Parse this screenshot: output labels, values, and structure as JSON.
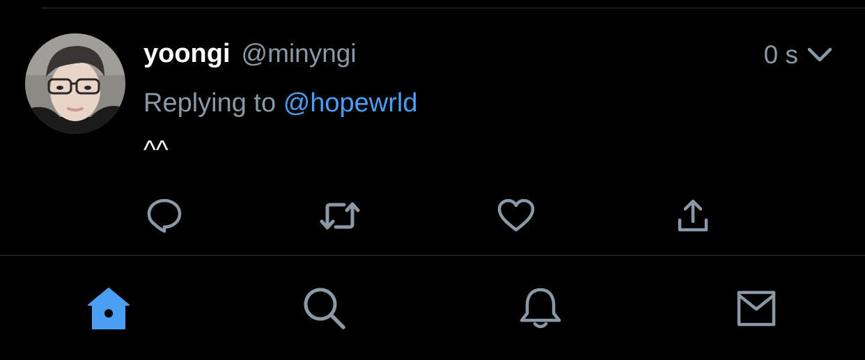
{
  "tweet": {
    "display_name": "yoongi",
    "handle": "@minyngi",
    "timestamp": "0 s",
    "reply_prefix": "Replying to",
    "reply_to": "@hopewrld",
    "text": "^^",
    "menu_icon": "chevron-down-icon",
    "actions": [
      {
        "name": "reply",
        "icon": "reply-bubble-icon"
      },
      {
        "name": "retweet",
        "icon": "retweet-icon"
      },
      {
        "name": "like",
        "icon": "heart-icon"
      },
      {
        "name": "share",
        "icon": "share-icon"
      }
    ]
  },
  "tabbar": {
    "tabs": [
      {
        "name": "home",
        "icon": "home-icon",
        "active": true
      },
      {
        "name": "search",
        "icon": "search-icon",
        "active": false
      },
      {
        "name": "notifications",
        "icon": "bell-icon",
        "active": false
      },
      {
        "name": "messages",
        "icon": "mail-icon",
        "active": false
      }
    ]
  },
  "colors": {
    "background": "#000000",
    "text_primary": "#ffffff",
    "text_secondary": "#8b98a5",
    "accent": "#4a9ff5",
    "divider": "#2f3336"
  }
}
